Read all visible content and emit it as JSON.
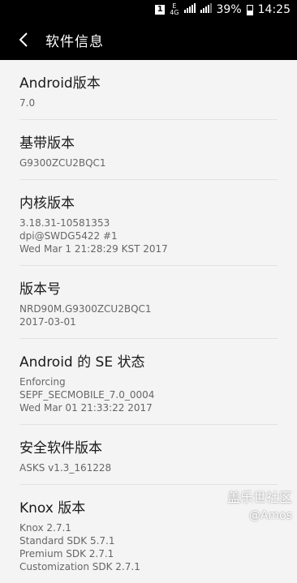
{
  "status_bar": {
    "sim": "1",
    "net_top": "E",
    "net_bottom": "4G",
    "battery": "39%",
    "time": "14:25"
  },
  "top_bar": {
    "title": "软件信息"
  },
  "items": [
    {
      "title": "Android版本",
      "value": "7.0"
    },
    {
      "title": "基带版本",
      "value": "G9300ZCU2BQC1"
    },
    {
      "title": "内核版本",
      "value": "3.18.31-10581353\ndpi@SWDG5422 #1\nWed Mar 1 21:28:29 KST 2017"
    },
    {
      "title": "版本号",
      "value": "NRD90M.G9300ZCU2BQC1\n2017-03-01"
    },
    {
      "title": "Android 的 SE 状态",
      "value": "Enforcing\nSEPF_SECMOBILE_7.0_0004\nWed Mar 01 21:33:22 2017"
    },
    {
      "title": "安全软件版本",
      "value": "ASKS v1.3_161228"
    },
    {
      "title": "Knox 版本",
      "value": "Knox 2.7.1\nStandard SDK 5.7.1\nPremium SDK 2.7.1\nCustomization SDK 2.7.1"
    }
  ],
  "watermark": {
    "brand": "盖乐世社区",
    "user": "@Amos"
  },
  "colors": {
    "background": "#f4f4f4",
    "bar": "#000000",
    "divider": "#e2e2e2"
  }
}
